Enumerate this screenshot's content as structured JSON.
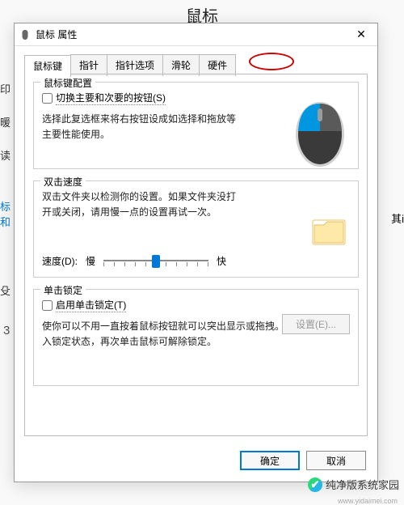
{
  "background": {
    "title": "鼠标",
    "sidebar_items": [
      "印",
      "暖",
      "读",
      "",
      "标和",
      "",
      "",
      "殳"
    ],
    "sidebar_blue_index": 4,
    "right_label": "其i",
    "num": "3"
  },
  "dialog": {
    "title": "鼠标 属性",
    "close": "✕",
    "tabs": [
      "鼠标键",
      "指针",
      "指针选项",
      "滑轮",
      "硬件"
    ],
    "active_tab": 0,
    "group1": {
      "title": "鼠标键配置",
      "checkbox_label": "切换主要和次要的按钮(S)",
      "desc": "选择此复选框来将右按钮设成如选择和拖放等主要性能使用。"
    },
    "group2": {
      "title": "双击速度",
      "desc": "双击文件夹以检测你的设置。如果文件夹没打开或关闭，请用慢一点的设置再试一次。",
      "speed_label": "速度(D):",
      "slow": "慢",
      "fast": "快"
    },
    "group3": {
      "title": "单击锁定",
      "checkbox_label": "启用单击锁定(T)",
      "setting_btn": "设置(E)...",
      "desc": "使你可以不用一直按着鼠标按钮就可以突出显示或拖拽。单击鼠标以进入锁定状态，再次单击鼠标可解除锁定。"
    },
    "ok": "确定",
    "cancel": "取消"
  },
  "watermark": {
    "text": "纯净版系统家园",
    "url": "www.yidaimei.com"
  }
}
